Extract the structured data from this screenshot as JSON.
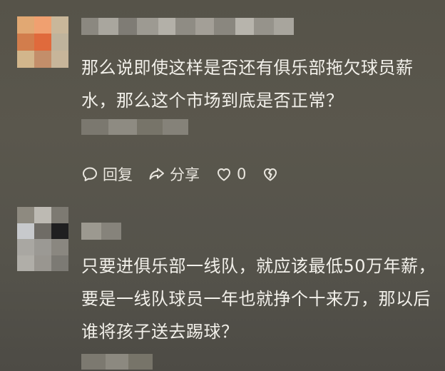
{
  "comments": [
    {
      "text": "那么说即使这样是否还有俱乐部拖欠球员薪水，那么这个市场到底是否正常？",
      "actions": {
        "reply_label": "回复",
        "share_label": "分享",
        "like_count": "0"
      },
      "icons": [
        "reply-icon",
        "share-icon",
        "like-heart-icon",
        "dislike-broken-heart-icon"
      ]
    },
    {
      "text": "只要进俱乐部一线队，就应该最低50万年薪，要是一线队球员一年也就挣个十来万，那以后谁将孩子送去踢球？"
    }
  ],
  "colors": {
    "background": "#575449",
    "text": "#f2f0ea",
    "avatar1_tones": [
      "#e1a873",
      "#f0a070",
      "#c9b79a",
      "#d27d4c",
      "#e06a3c",
      "#bfb39c",
      "#d2b68c",
      "#c38e6a",
      "#c7b59a"
    ],
    "avatar2_tones": [
      "#8e8a80",
      "#bdbab3",
      "#7d7a72",
      "#c7c9cc",
      "#6f6c66",
      "#1f1f20",
      "#a9a7a2",
      "#9b9994",
      "#8a8780",
      "#b0aea8",
      "#999690",
      "#7c7a74"
    ]
  }
}
